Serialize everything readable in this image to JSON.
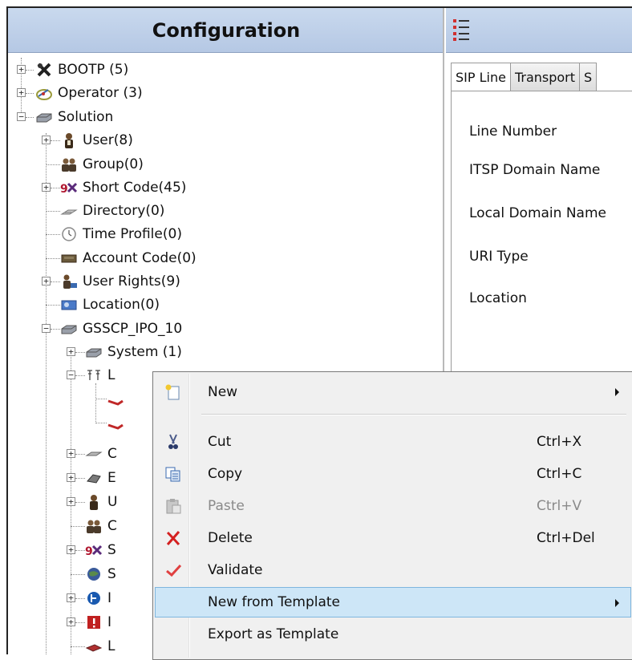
{
  "left_pane": {
    "title": "Configuration"
  },
  "tree": {
    "bootp": "BOOTP (5)",
    "operator": "Operator (3)",
    "solution": "Solution",
    "user": "User(8)",
    "group": "Group(0)",
    "short_code": "Short Code(45)",
    "directory": "Directory(0)",
    "time_profile": "Time Profile(0)",
    "account_code": "Account Code(0)",
    "user_rights": "User Rights(9)",
    "location": "Location(0)",
    "gsscp": "GSSCP_IPO_10",
    "system": "System (1)",
    "line_partial": "L",
    "c1": "C",
    "e1": "E",
    "u1": "U",
    "c2": "C",
    "s1": "S",
    "s2": "S",
    "i1": "I",
    "i2": "I",
    "l2": "L"
  },
  "right_pane": {
    "tabs": [
      "SIP Line",
      "Transport",
      "S"
    ],
    "fields": [
      "Line Number",
      "ITSP Domain Name",
      "Local Domain Name",
      "URI Type",
      "Location"
    ]
  },
  "context_menu": {
    "items": [
      {
        "label": "New",
        "shortcut": "",
        "submenu": true,
        "icon": "new-document-icon"
      },
      {
        "label": "Cut",
        "shortcut": "Ctrl+X",
        "icon": "scissors-icon"
      },
      {
        "label": "Copy",
        "shortcut": "Ctrl+C",
        "icon": "copy-icon"
      },
      {
        "label": "Paste",
        "shortcut": "Ctrl+V",
        "icon": "paste-icon",
        "disabled": true
      },
      {
        "label": "Delete",
        "shortcut": "Ctrl+Del",
        "icon": "delete-x-icon"
      },
      {
        "label": "Validate",
        "shortcut": "",
        "icon": "checkmark-icon"
      },
      {
        "label": "New from Template",
        "shortcut": "",
        "submenu": true,
        "highlighted": true
      },
      {
        "label": "Export as Template",
        "shortcut": ""
      }
    ]
  },
  "colors": {
    "header_blue": "#b5c8e4",
    "menu_highlight": "#cde6f7",
    "delete_red": "#d42020",
    "validate_red": "#e04040"
  }
}
